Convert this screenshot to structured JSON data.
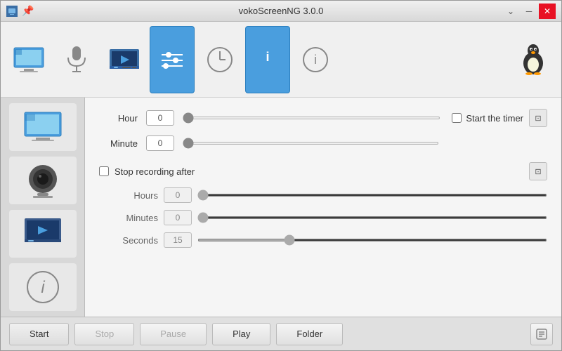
{
  "window": {
    "title": "vokoScreenNG 3.0.0",
    "pin_icon": "📌",
    "minimize_label": "─",
    "maximize_label": "▲",
    "close_label": "✕"
  },
  "toolbar": {
    "buttons": [
      {
        "id": "screen",
        "label": "",
        "active": false
      },
      {
        "id": "webcam",
        "label": "",
        "active": false
      },
      {
        "id": "video",
        "label": "",
        "active": false
      },
      {
        "id": "settings",
        "label": "",
        "active": false
      },
      {
        "id": "timer",
        "label": "",
        "active": false
      },
      {
        "id": "chat",
        "label": "",
        "active": true
      },
      {
        "id": "info",
        "label": "",
        "active": false
      }
    ],
    "tux_label": "🐧"
  },
  "sidebar": {
    "items": [
      {
        "id": "screen-main",
        "label": ""
      },
      {
        "id": "webcam-main",
        "label": ""
      },
      {
        "id": "player",
        "label": ""
      },
      {
        "id": "about",
        "label": ""
      }
    ]
  },
  "form": {
    "hour_label": "Hour",
    "hour_value": "0",
    "minute_label": "Minute",
    "minute_value": "0",
    "start_timer_label": "Start the timer",
    "stop_recording_label": "Stop recording after",
    "hours_label": "Hours",
    "hours_value": "0",
    "minutes_label": "Minutes",
    "minutes_value": "0",
    "seconds_label": "Seconds",
    "seconds_value": "15"
  },
  "bottom": {
    "start_label": "Start",
    "stop_label": "Stop",
    "pause_label": "Pause",
    "play_label": "Play",
    "folder_label": "Folder"
  }
}
